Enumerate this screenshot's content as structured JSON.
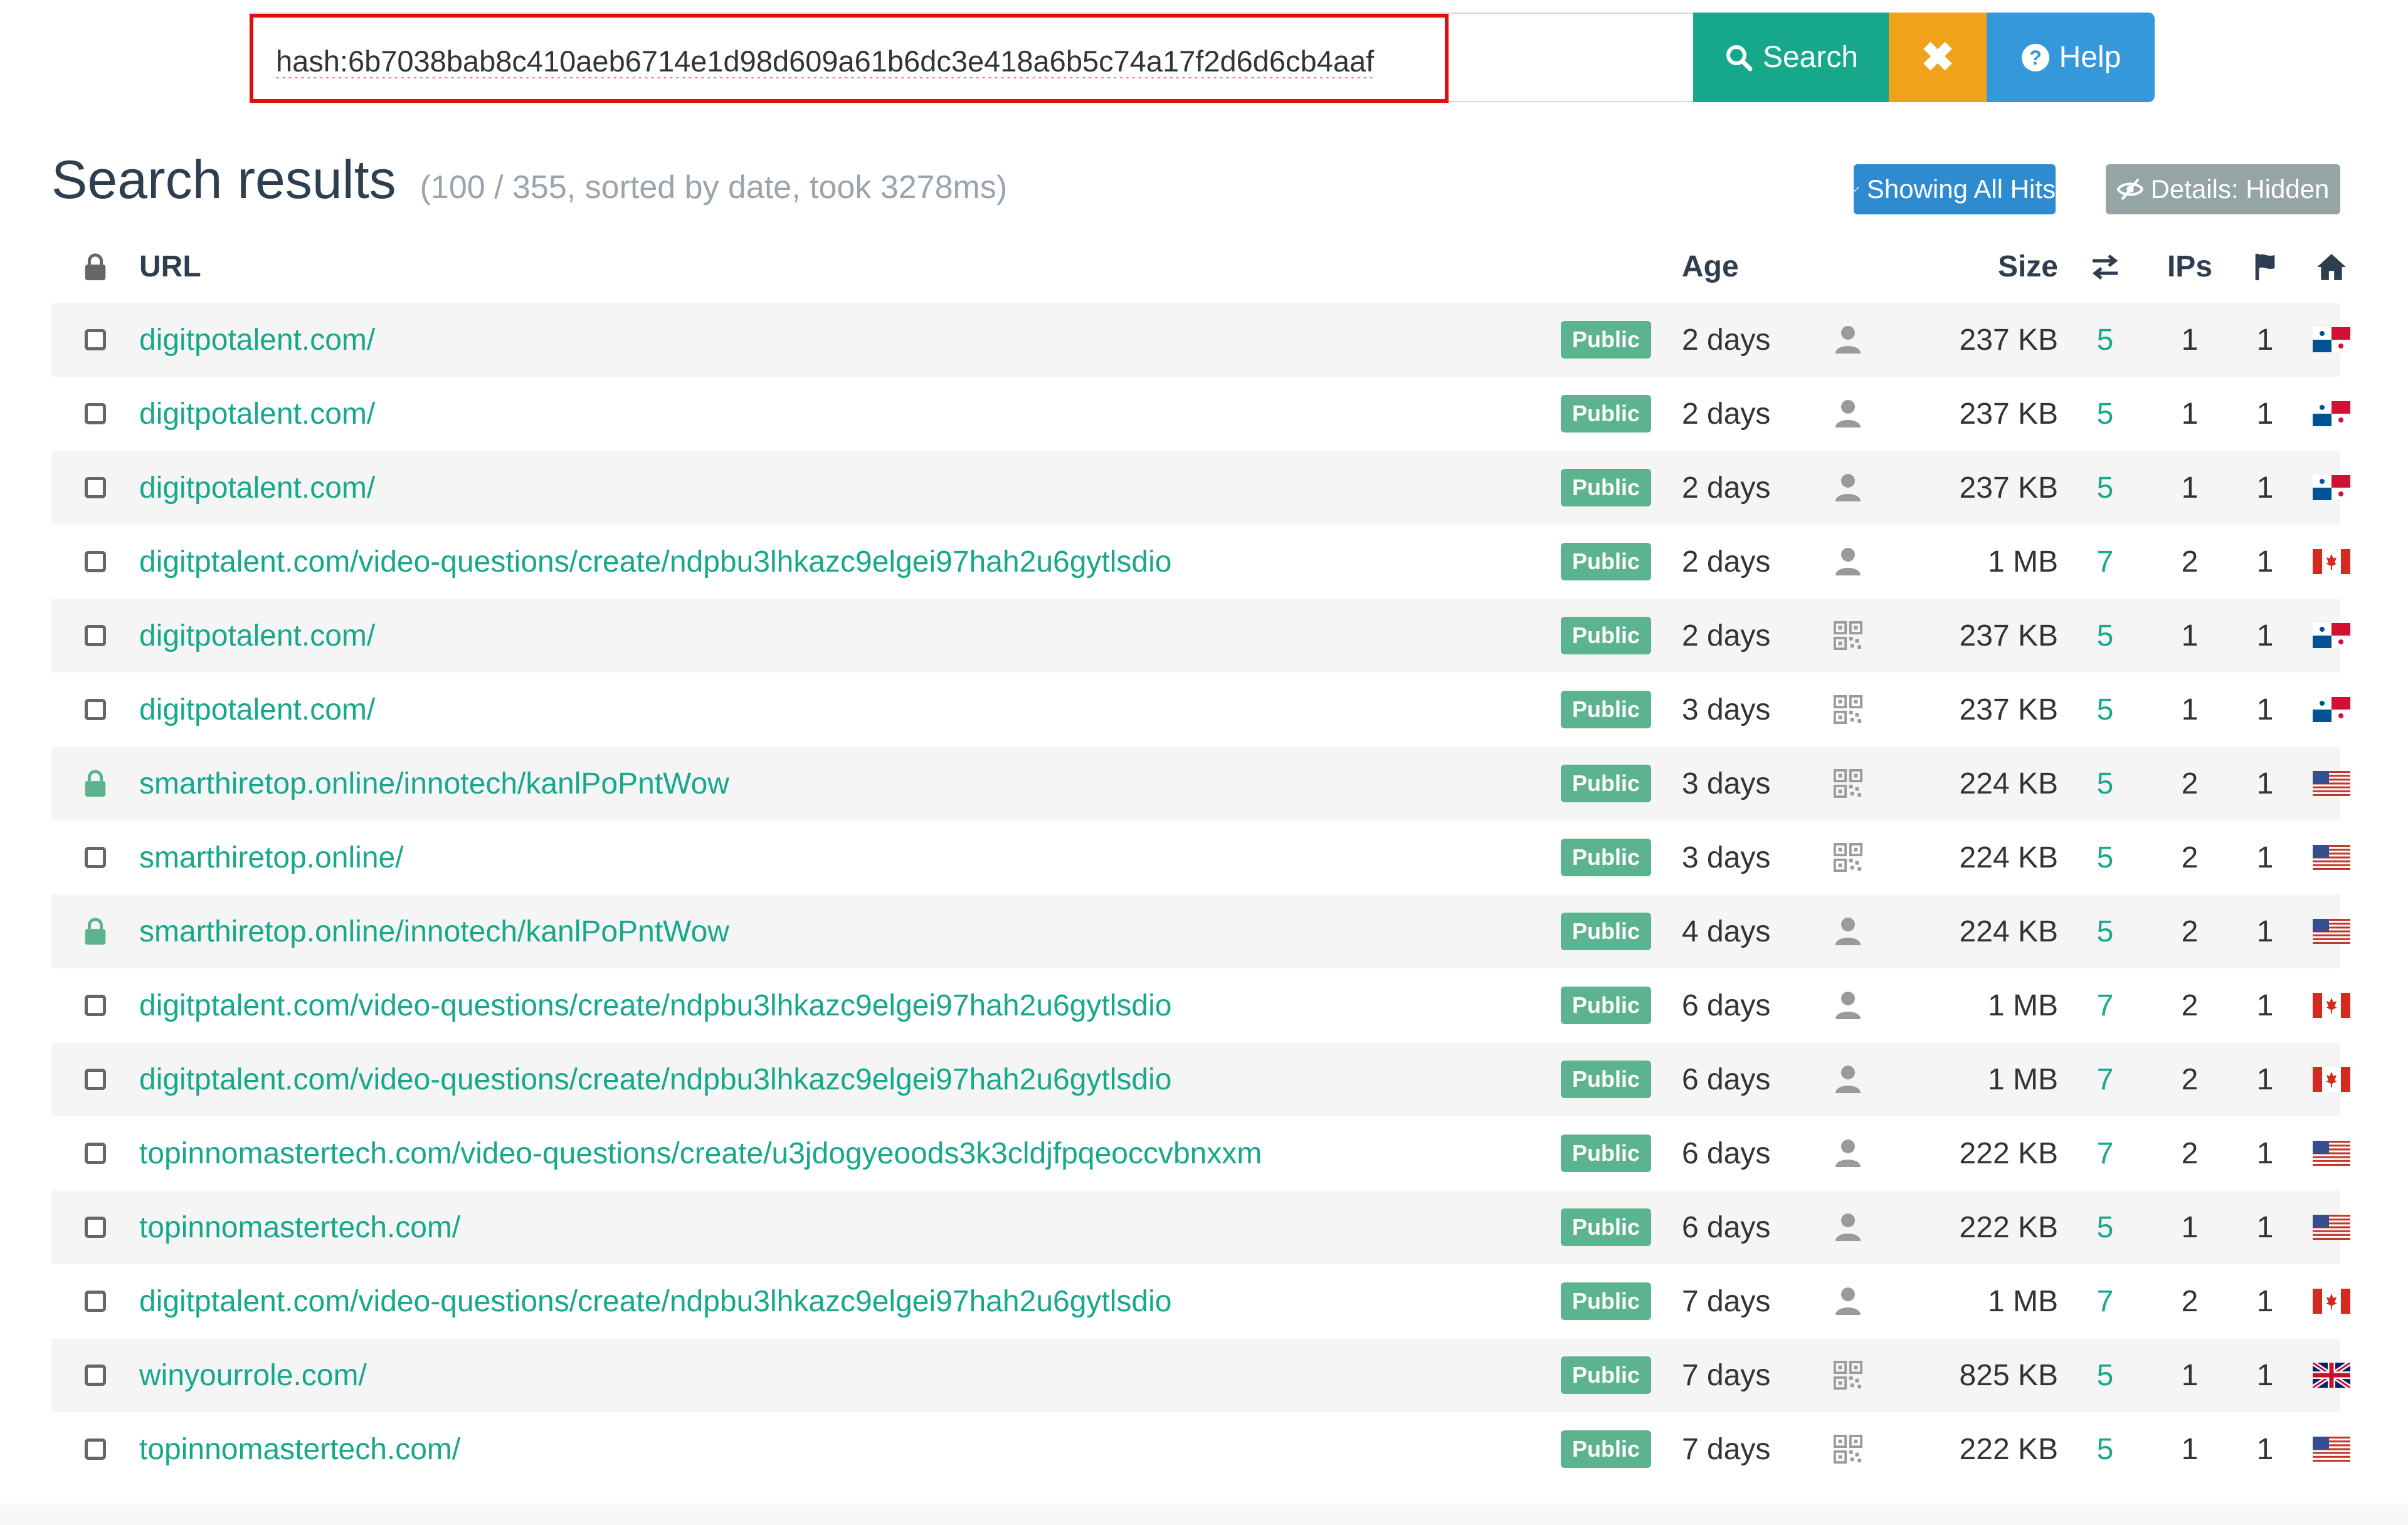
{
  "search": {
    "query": "hash:6b7038bab8c410aeb6714e1d98d609a61b6dc3e418a6b5c74a17f2d6d6cb4aaf",
    "search_label": "Search",
    "clear_label": "✖",
    "help_label": "Help"
  },
  "header": {
    "title": "Search results",
    "meta": "(100 / 355, sorted by date, took 3278ms)",
    "showing_label": "Showing All Hits",
    "details_label": "Details: Hidden"
  },
  "columns": {
    "url": "URL",
    "age": "Age",
    "size": "Size",
    "ips": "IPs"
  },
  "colors": {
    "accent": "#17a88c",
    "warning": "#f0a21b",
    "info": "#3498db",
    "badge": "#5cb38f",
    "highlight": "#e00f0f"
  },
  "rows": [
    {
      "lock": false,
      "url": "digitpotalent.com/",
      "badge": "Public",
      "age": "2 days",
      "user_icon": "user-icon",
      "size": "237 KB",
      "redirects": "5",
      "ips": "1",
      "countries": "1",
      "flag": "pa"
    },
    {
      "lock": false,
      "url": "digitpotalent.com/",
      "badge": "Public",
      "age": "2 days",
      "user_icon": "user-icon",
      "size": "237 KB",
      "redirects": "5",
      "ips": "1",
      "countries": "1",
      "flag": "pa"
    },
    {
      "lock": false,
      "url": "digitpotalent.com/",
      "badge": "Public",
      "age": "2 days",
      "user_icon": "user-icon",
      "size": "237 KB",
      "redirects": "5",
      "ips": "1",
      "countries": "1",
      "flag": "pa"
    },
    {
      "lock": false,
      "url": "digitptalent.com/video-questions/create/ndpbu3lhkazc9elgei97hah2u6gytlsdio",
      "badge": "Public",
      "age": "2 days",
      "user_icon": "user-icon",
      "size": "1 MB",
      "redirects": "7",
      "ips": "2",
      "countries": "1",
      "flag": "ca"
    },
    {
      "lock": false,
      "url": "digitpotalent.com/",
      "badge": "Public",
      "age": "2 days",
      "user_icon": "qr-icon",
      "size": "237 KB",
      "redirects": "5",
      "ips": "1",
      "countries": "1",
      "flag": "pa"
    },
    {
      "lock": false,
      "url": "digitpotalent.com/",
      "badge": "Public",
      "age": "3 days",
      "user_icon": "qr-icon",
      "size": "237 KB",
      "redirects": "5",
      "ips": "1",
      "countries": "1",
      "flag": "pa"
    },
    {
      "lock": true,
      "url": "smarthiretop.online/innotech/kanlPoPntWow",
      "badge": "Public",
      "age": "3 days",
      "user_icon": "qr-icon",
      "size": "224 KB",
      "redirects": "5",
      "ips": "2",
      "countries": "1",
      "flag": "us"
    },
    {
      "lock": false,
      "url": "smarthiretop.online/",
      "badge": "Public",
      "age": "3 days",
      "user_icon": "qr-icon",
      "size": "224 KB",
      "redirects": "5",
      "ips": "2",
      "countries": "1",
      "flag": "us"
    },
    {
      "lock": true,
      "url": "smarthiretop.online/innotech/kanlPoPntWow",
      "badge": "Public",
      "age": "4 days",
      "user_icon": "user-icon",
      "size": "224 KB",
      "redirects": "5",
      "ips": "2",
      "countries": "1",
      "flag": "us"
    },
    {
      "lock": false,
      "url": "digitptalent.com/video-questions/create/ndpbu3lhkazc9elgei97hah2u6gytlsdio",
      "badge": "Public",
      "age": "6 days",
      "user_icon": "user-icon",
      "size": "1 MB",
      "redirects": "7",
      "ips": "2",
      "countries": "1",
      "flag": "ca"
    },
    {
      "lock": false,
      "url": "digitptalent.com/video-questions/create/ndpbu3lhkazc9elgei97hah2u6gytlsdio",
      "badge": "Public",
      "age": "6 days",
      "user_icon": "user-icon",
      "size": "1 MB",
      "redirects": "7",
      "ips": "2",
      "countries": "1",
      "flag": "ca"
    },
    {
      "lock": false,
      "url": "topinnomastertech.com/video-questions/create/u3jdogyeoods3k3cldjfpqeoccvbnxxm",
      "badge": "Public",
      "age": "6 days",
      "user_icon": "user-icon",
      "size": "222 KB",
      "redirects": "7",
      "ips": "2",
      "countries": "1",
      "flag": "us"
    },
    {
      "lock": false,
      "url": "topinnomastertech.com/",
      "badge": "Public",
      "age": "6 days",
      "user_icon": "user-icon",
      "size": "222 KB",
      "redirects": "5",
      "ips": "1",
      "countries": "1",
      "flag": "us"
    },
    {
      "lock": false,
      "url": "digitptalent.com/video-questions/create/ndpbu3lhkazc9elgei97hah2u6gytlsdio",
      "badge": "Public",
      "age": "7 days",
      "user_icon": "user-icon",
      "size": "1 MB",
      "redirects": "7",
      "ips": "2",
      "countries": "1",
      "flag": "ca"
    },
    {
      "lock": false,
      "url": "winyourrole.com/",
      "badge": "Public",
      "age": "7 days",
      "user_icon": "qr-icon",
      "size": "825 KB",
      "redirects": "5",
      "ips": "1",
      "countries": "1",
      "flag": "gb"
    },
    {
      "lock": false,
      "url": "topinnomastertech.com/",
      "badge": "Public",
      "age": "7 days",
      "user_icon": "qr-icon",
      "size": "222 KB",
      "redirects": "5",
      "ips": "1",
      "countries": "1",
      "flag": "us"
    }
  ]
}
